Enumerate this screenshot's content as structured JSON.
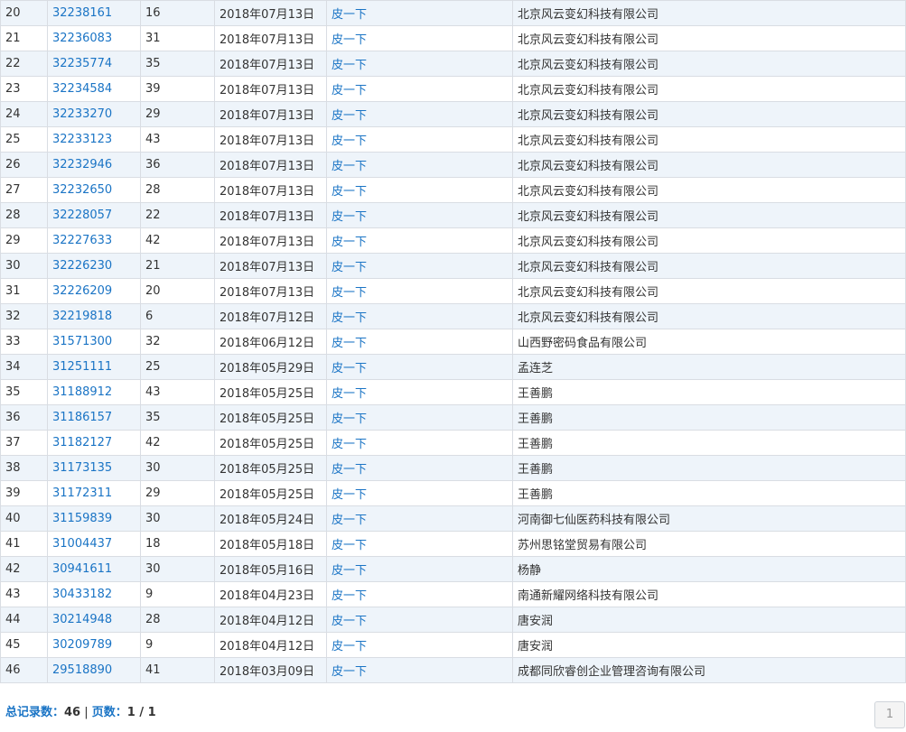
{
  "rows": [
    {
      "idx": "20",
      "reg": "32238161",
      "cls": "16",
      "date": "2018年07月13日",
      "action": "皮一下",
      "applicant": "北京风云变幻科技有限公司"
    },
    {
      "idx": "21",
      "reg": "32236083",
      "cls": "31",
      "date": "2018年07月13日",
      "action": "皮一下",
      "applicant": "北京风云变幻科技有限公司"
    },
    {
      "idx": "22",
      "reg": "32235774",
      "cls": "35",
      "date": "2018年07月13日",
      "action": "皮一下",
      "applicant": "北京风云变幻科技有限公司"
    },
    {
      "idx": "23",
      "reg": "32234584",
      "cls": "39",
      "date": "2018年07月13日",
      "action": "皮一下",
      "applicant": "北京风云变幻科技有限公司"
    },
    {
      "idx": "24",
      "reg": "32233270",
      "cls": "29",
      "date": "2018年07月13日",
      "action": "皮一下",
      "applicant": "北京风云变幻科技有限公司"
    },
    {
      "idx": "25",
      "reg": "32233123",
      "cls": "43",
      "date": "2018年07月13日",
      "action": "皮一下",
      "applicant": "北京风云变幻科技有限公司"
    },
    {
      "idx": "26",
      "reg": "32232946",
      "cls": "36",
      "date": "2018年07月13日",
      "action": "皮一下",
      "applicant": "北京风云变幻科技有限公司"
    },
    {
      "idx": "27",
      "reg": "32232650",
      "cls": "28",
      "date": "2018年07月13日",
      "action": "皮一下",
      "applicant": "北京风云变幻科技有限公司"
    },
    {
      "idx": "28",
      "reg": "32228057",
      "cls": "22",
      "date": "2018年07月13日",
      "action": "皮一下",
      "applicant": "北京风云变幻科技有限公司"
    },
    {
      "idx": "29",
      "reg": "32227633",
      "cls": "42",
      "date": "2018年07月13日",
      "action": "皮一下",
      "applicant": "北京风云变幻科技有限公司"
    },
    {
      "idx": "30",
      "reg": "32226230",
      "cls": "21",
      "date": "2018年07月13日",
      "action": "皮一下",
      "applicant": "北京风云变幻科技有限公司"
    },
    {
      "idx": "31",
      "reg": "32226209",
      "cls": "20",
      "date": "2018年07月13日",
      "action": "皮一下",
      "applicant": "北京风云变幻科技有限公司"
    },
    {
      "idx": "32",
      "reg": "32219818",
      "cls": "6",
      "date": "2018年07月12日",
      "action": "皮一下",
      "applicant": "北京风云变幻科技有限公司"
    },
    {
      "idx": "33",
      "reg": "31571300",
      "cls": "32",
      "date": "2018年06月12日",
      "action": "皮一下",
      "applicant": "山西野密码食品有限公司"
    },
    {
      "idx": "34",
      "reg": "31251111",
      "cls": "25",
      "date": "2018年05月29日",
      "action": "皮一下",
      "applicant": "孟连芝"
    },
    {
      "idx": "35",
      "reg": "31188912",
      "cls": "43",
      "date": "2018年05月25日",
      "action": "皮一下",
      "applicant": "王善鹏"
    },
    {
      "idx": "36",
      "reg": "31186157",
      "cls": "35",
      "date": "2018年05月25日",
      "action": "皮一下",
      "applicant": "王善鹏"
    },
    {
      "idx": "37",
      "reg": "31182127",
      "cls": "42",
      "date": "2018年05月25日",
      "action": "皮一下",
      "applicant": "王善鹏"
    },
    {
      "idx": "38",
      "reg": "31173135",
      "cls": "30",
      "date": "2018年05月25日",
      "action": "皮一下",
      "applicant": "王善鹏"
    },
    {
      "idx": "39",
      "reg": "31172311",
      "cls": "29",
      "date": "2018年05月25日",
      "action": "皮一下",
      "applicant": "王善鹏"
    },
    {
      "idx": "40",
      "reg": "31159839",
      "cls": "30",
      "date": "2018年05月24日",
      "action": "皮一下",
      "applicant": "河南御七仙医药科技有限公司"
    },
    {
      "idx": "41",
      "reg": "31004437",
      "cls": "18",
      "date": "2018年05月18日",
      "action": "皮一下",
      "applicant": "苏州思铭堂贸易有限公司"
    },
    {
      "idx": "42",
      "reg": "30941611",
      "cls": "30",
      "date": "2018年05月16日",
      "action": "皮一下",
      "applicant": "杨静"
    },
    {
      "idx": "43",
      "reg": "30433182",
      "cls": "9",
      "date": "2018年04月23日",
      "action": "皮一下",
      "applicant": "南通新耀网络科技有限公司"
    },
    {
      "idx": "44",
      "reg": "30214948",
      "cls": "28",
      "date": "2018年04月12日",
      "action": "皮一下",
      "applicant": "唐安润"
    },
    {
      "idx": "45",
      "reg": "30209789",
      "cls": "9",
      "date": "2018年04月12日",
      "action": "皮一下",
      "applicant": "唐安润"
    },
    {
      "idx": "46",
      "reg": "29518890",
      "cls": "41",
      "date": "2018年03月09日",
      "action": "皮一下",
      "applicant": "成都同欣睿创企业管理咨询有限公司"
    }
  ],
  "footer": {
    "total_label": "总记录数：",
    "total_value": "46",
    "separator": " | ",
    "pages_label": "页数：",
    "pages_value": "1 / 1"
  },
  "pagination": {
    "current": "1"
  }
}
